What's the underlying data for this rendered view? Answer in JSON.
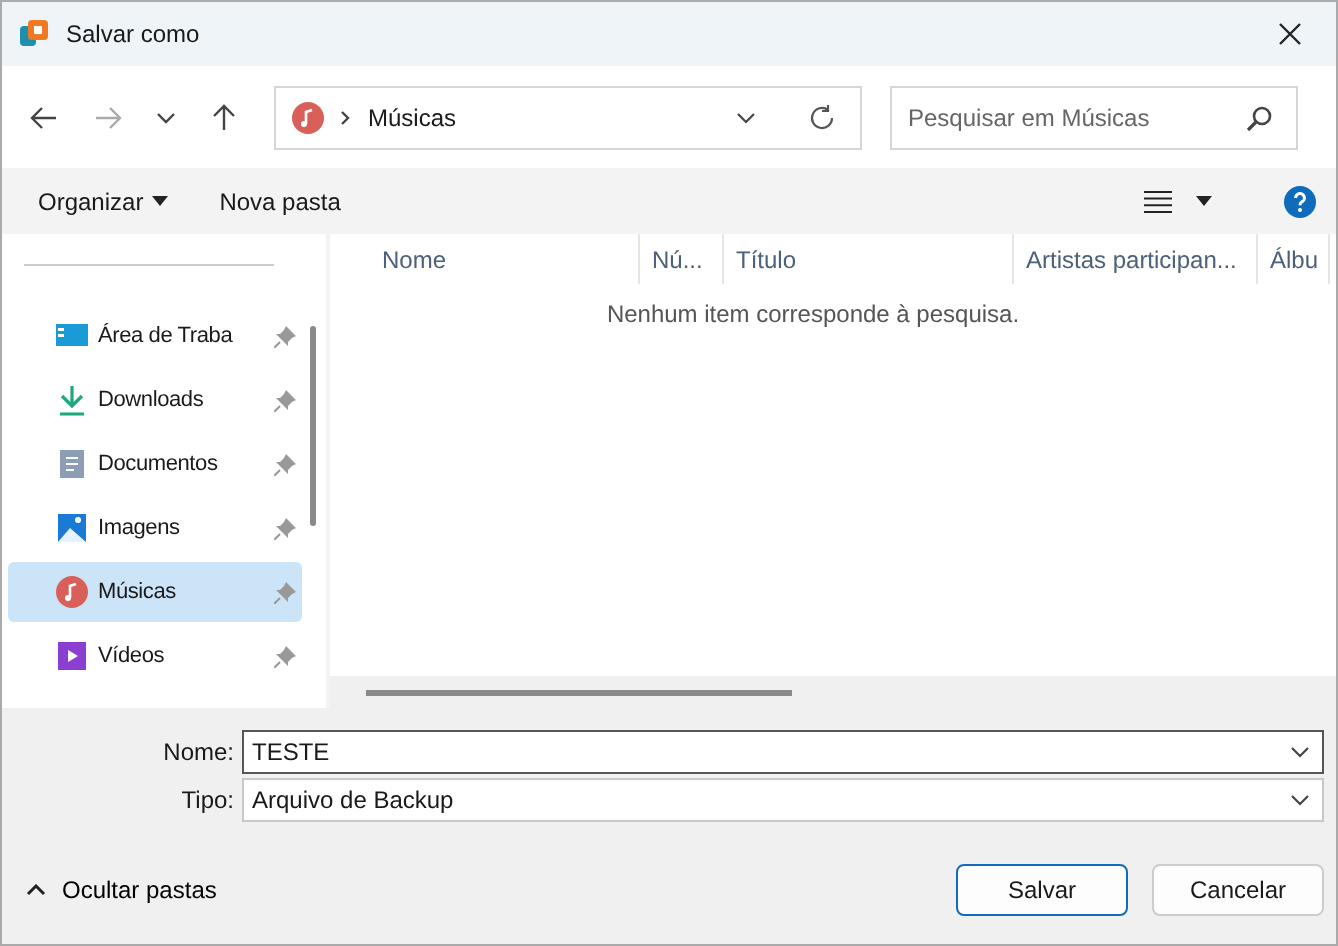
{
  "window": {
    "title": "Salvar como"
  },
  "nav": {
    "location": "Músicas",
    "search_placeholder": "Pesquisar em Músicas"
  },
  "toolbar": {
    "organize": "Organizar",
    "new_folder": "Nova pasta"
  },
  "sidebar": {
    "items": [
      {
        "label": "Área de Traba",
        "kind": "desktop",
        "selected": false
      },
      {
        "label": "Downloads",
        "kind": "download",
        "selected": false
      },
      {
        "label": "Documentos",
        "kind": "document",
        "selected": false
      },
      {
        "label": "Imagens",
        "kind": "image",
        "selected": false
      },
      {
        "label": "Músicas",
        "kind": "music",
        "selected": true
      },
      {
        "label": "Vídeos",
        "kind": "video",
        "selected": false
      }
    ]
  },
  "table": {
    "columns": [
      "Nome",
      "Nú...",
      "Título",
      "Artistas participan...",
      "Álbu"
    ],
    "empty_message": "Nenhum item corresponde à pesquisa."
  },
  "form": {
    "name_label": "Nome:",
    "name_value": "TESTE",
    "type_label": "Tipo:",
    "type_value": "Arquivo de Backup"
  },
  "footer": {
    "hide_folders": "Ocultar pastas",
    "save": "Salvar",
    "cancel": "Cancelar"
  }
}
